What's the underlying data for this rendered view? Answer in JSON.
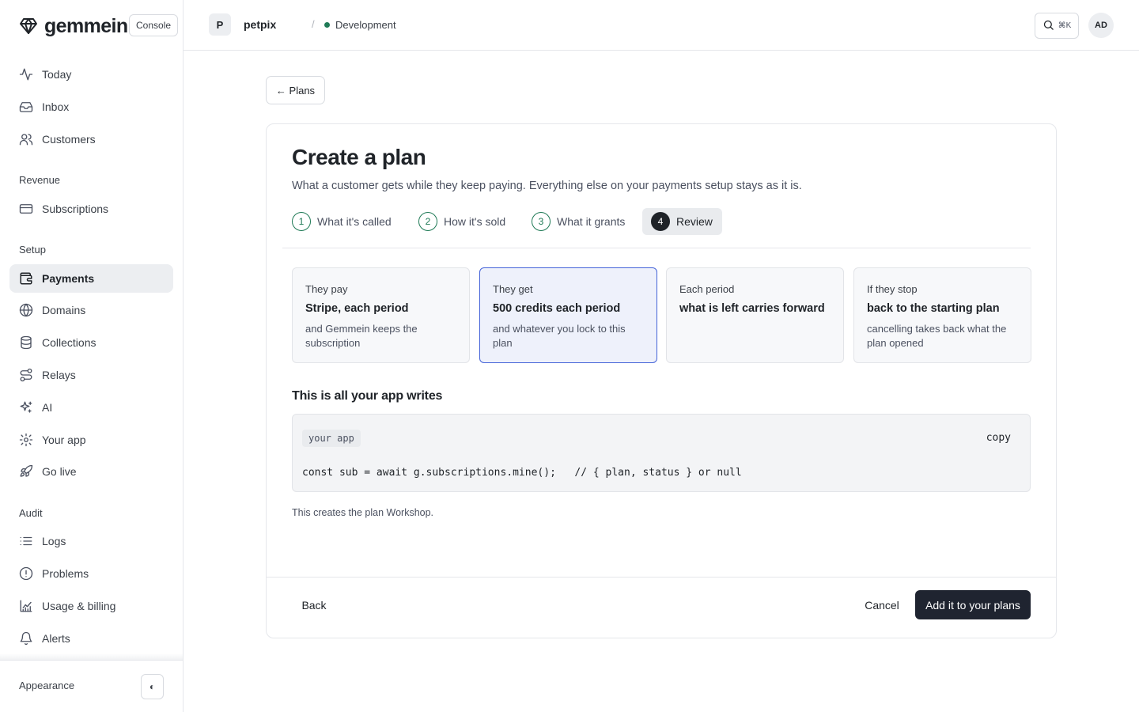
{
  "brand": {
    "name": "gemmein",
    "tag": "Console",
    "logo_icon": "diamond-icon"
  },
  "sidebar": {
    "primary": [
      {
        "label": "Today",
        "icon": "activity-icon"
      },
      {
        "label": "Inbox",
        "icon": "inbox-icon"
      },
      {
        "label": "Customers",
        "icon": "users-icon"
      }
    ],
    "sections": [
      {
        "title": "Revenue",
        "items": [
          {
            "label": "Subscriptions",
            "icon": "credit-card-icon"
          }
        ]
      },
      {
        "title": "Setup",
        "items": [
          {
            "label": "Payments",
            "icon": "wallet-icon",
            "active": true
          },
          {
            "label": "Domains",
            "icon": "globe-icon"
          },
          {
            "label": "Collections",
            "icon": "database-icon"
          },
          {
            "label": "Relays",
            "icon": "route-icon"
          },
          {
            "label": "AI",
            "icon": "sparkles-icon"
          },
          {
            "label": "Your app",
            "icon": "gear-icon"
          },
          {
            "label": "Go live",
            "icon": "rocket-icon"
          }
        ]
      },
      {
        "title": "Audit",
        "items": [
          {
            "label": "Logs",
            "icon": "list-icon"
          },
          {
            "label": "Problems",
            "icon": "alert-circle-icon"
          },
          {
            "label": "Usage & billing",
            "icon": "chart-icon"
          },
          {
            "label": "Alerts",
            "icon": "bell-icon"
          }
        ]
      }
    ],
    "footer": {
      "appearance_label": "Appearance",
      "toggle_glyph": "◐"
    }
  },
  "topbar": {
    "project_initial": "P",
    "project_name": "petpix",
    "separator": "/",
    "environment": "Development",
    "search_shortcut": "⌘K",
    "user_initials": "AD"
  },
  "main": {
    "back_label": "← Plans",
    "title": "Create a plan",
    "subtitle": "What a customer gets while they keep paying. Everything else on your payments setup stays as it is.",
    "steps": [
      {
        "num": "1",
        "label": "What it's called"
      },
      {
        "num": "2",
        "label": "How it's sold"
      },
      {
        "num": "3",
        "label": "What it grants"
      },
      {
        "num": "4",
        "label": "Review",
        "current": true
      }
    ],
    "summary": [
      {
        "label": "They pay",
        "value": "Stripe, each period",
        "note": "and Gemmein keeps the subscription"
      },
      {
        "label": "They get",
        "value": "500 credits each period",
        "note": "and whatever you lock to this plan"
      },
      {
        "label": "Each period",
        "value": "what is left carries forward",
        "note": ""
      },
      {
        "label": "If they stop",
        "value": "back to the starting plan",
        "note": "cancelling takes back what the plan opened"
      }
    ],
    "code_heading": "This is all your app writes",
    "code": {
      "file_label": "your app",
      "copy_label": "copy",
      "line": "const sub = await g.subscriptions.mine();   // { plan, status } or null"
    },
    "code_note": "This creates the plan Workshop.",
    "footer": {
      "back_label": "Back",
      "cancel_label": "Cancel",
      "primary_label": "Add it to your plans"
    }
  },
  "colors": {
    "accent_green": "#1f7a56",
    "highlight_blue": "#4463d8",
    "primary_button": "#1f2430"
  }
}
